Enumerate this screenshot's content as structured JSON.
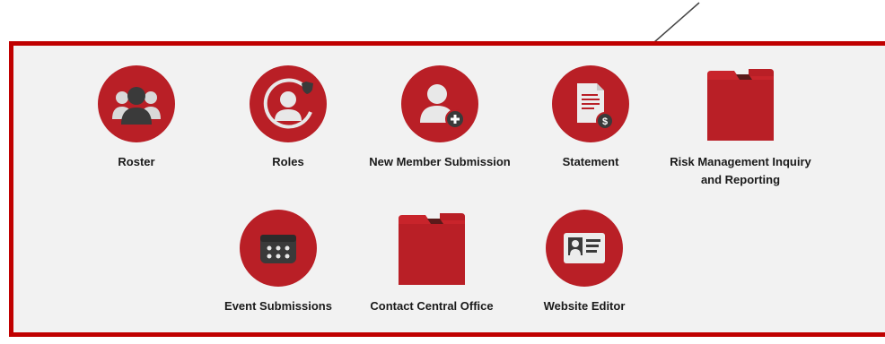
{
  "colors": {
    "panel_border": "#c00000",
    "panel_bg": "#f2f2f2",
    "icon_red": "#b91f26",
    "icon_dark": "#3a3a3a",
    "arrow": "#444444"
  },
  "tiles": [
    {
      "label": "Roster",
      "icon": "people-group-icon"
    },
    {
      "label": "Roles",
      "icon": "user-role-icon"
    },
    {
      "label": "New Member Submission",
      "icon": "add-member-icon"
    },
    {
      "label": "Statement",
      "icon": "statement-document-icon"
    },
    {
      "label_lines": [
        "Risk Management Inquiry",
        "and Reporting"
      ],
      "icon": "folder-icon"
    },
    {
      "label": "Event Submissions",
      "icon": "calendar-icon"
    },
    {
      "label": "Contact Central Office",
      "icon": "folder-icon"
    },
    {
      "label": "Website Editor",
      "icon": "id-card-icon"
    }
  ]
}
